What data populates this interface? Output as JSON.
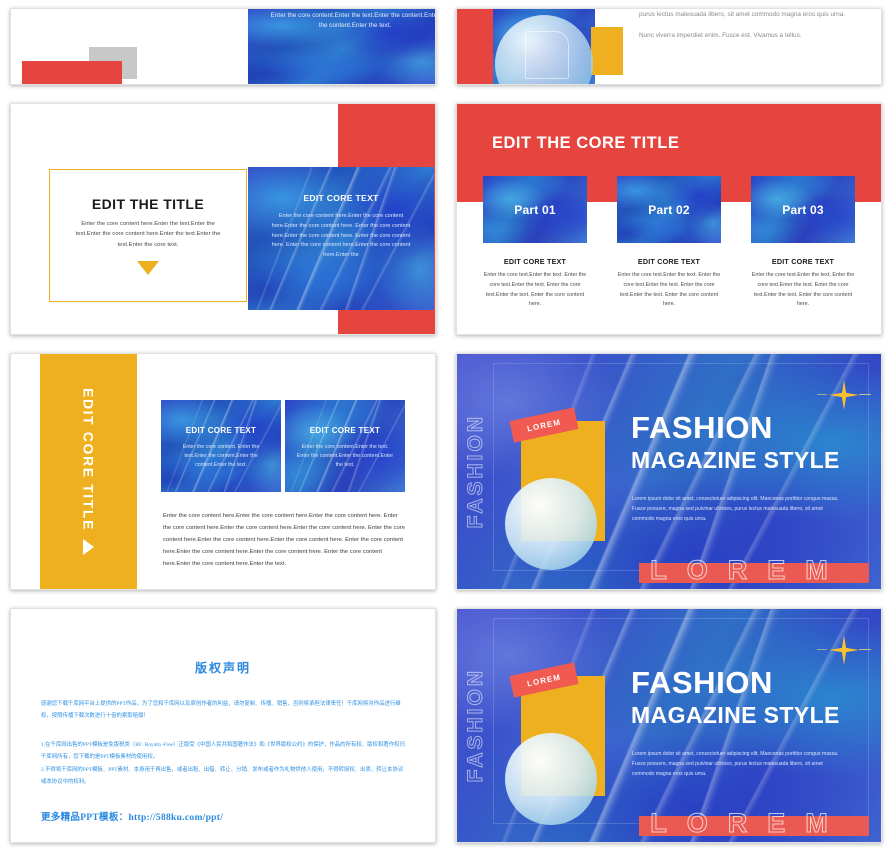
{
  "deck": {
    "accent_red": "#E5453E",
    "accent_yellow": "#EFB01F",
    "accent_blue": "#2B37B5",
    "link_blue": "#2B8AE0"
  },
  "slide1": {
    "overlay_text": "Enter the core content.Enter the text.Enter the content.Enter the content.Enter the text."
  },
  "slide2": {
    "paragraph1": "purus lectus malesuada libero, sit amet commodo magna eros quis urna.",
    "paragraph2": "Nunc viverra imperdiet enim. Fusce est. Vivamus a tellus."
  },
  "slide3": {
    "title": "EDIT THE TITLE",
    "subtitle": "Enter the core content here.Enter the text.Enter the text.Enter the core content here.Enter the text.Enter the text.Enter the core text.",
    "card_title": "EDIT CORE TEXT",
    "card_body": "Enter the core content here.Enter the core content here.Enter the core content here. Enter the core content here.Enter the core content here. Enter the core content here. Enter the core content here.Enter the core content here.Enter the"
  },
  "slide4": {
    "title": "EDIT THE CORE TITLE",
    "parts": [
      {
        "label": "Part 01",
        "heading": "EDIT CORE TEXT",
        "body": "Enter the core text.Enter the text. Enter the core text.Enter the text. Enter the core text.Enter the text. Enter the core content here."
      },
      {
        "label": "Part 02",
        "heading": "EDIT CORE TEXT",
        "body": "Enter the core text.Enter the text. Enter the core text.Enter the text. Enter the core text.Enter the text. Enter the core content here."
      },
      {
        "label": "Part 03",
        "heading": "EDIT CORE TEXT",
        "body": "Enter the core text.Enter the text. Enter the core text.Enter the text. Enter the core text.Enter the text. Enter the core content here."
      }
    ]
  },
  "slide5": {
    "vertical_title": "EDIT CORE TITLE",
    "cards": [
      {
        "heading": "EDIT CORE TEXT",
        "body": "Enter the core content. Enter the text.Enter the content.Enter the content.Enter the text."
      },
      {
        "heading": "EDIT CORE TEXT",
        "body": "Enter the core content.Enter the text. Enter the content.Enter the content.Enter the text."
      }
    ],
    "body": "Enter the core content here.Enter the core content here.Enter the core content here. Enter the core content here.Enter the core content here.Enter the core content here. Enter the core content here.Enter the core content here.Enter the core content here. Enter the core content here.Enter the core content here.Enter the core content here. Enter the core content here.Enter the core content here.Enter the text."
  },
  "hero": {
    "vertical_label": "FASHION",
    "tag": "LOREM",
    "title_line1": "FASHION",
    "title_line2": "MAGAZINE STYLE",
    "body": "Lorem ipsum dolor sit amet, consectetuer adipiscing elit. Maecenas porttitor congue massa. Fusce posuere, magna sed pulvinar ultricies, purus lectus malesuada libero, sit amet commodo magna eros quis urna.",
    "footer_word": "LOREM"
  },
  "copyright": {
    "heading": "版权声明",
    "paragraph1": "感谢您下载千库网平台上提供的PPT作品，为了您和千库网以及原创作者的利益，请勿复制、传播、销售，否则将承担法律责任！千库网将对作品进行维权，按照传播下载次数进行十倍的索取赔偿！",
    "paragraph2": "1.在千库网出售的PPT模板是免版税类（RF: Royalty-Free）正版受《中国人民共和国著作法》和《世界版权公约》的保护，作品的所有权、版权和著作权归千库网所有，您下载的是PPT模板素材的使用权。",
    "paragraph3": "2.不得将千库网的PPT模板、PPT素材、本身用于再出售，或者出租、出借、转让、分销、发布或者作为礼物供他人使用，不得转授权、出卖、转让本协议或本协议中的权利。",
    "more_label": "更多精品PPT模板：",
    "more_url": "http://588ku.com/ppt/"
  }
}
